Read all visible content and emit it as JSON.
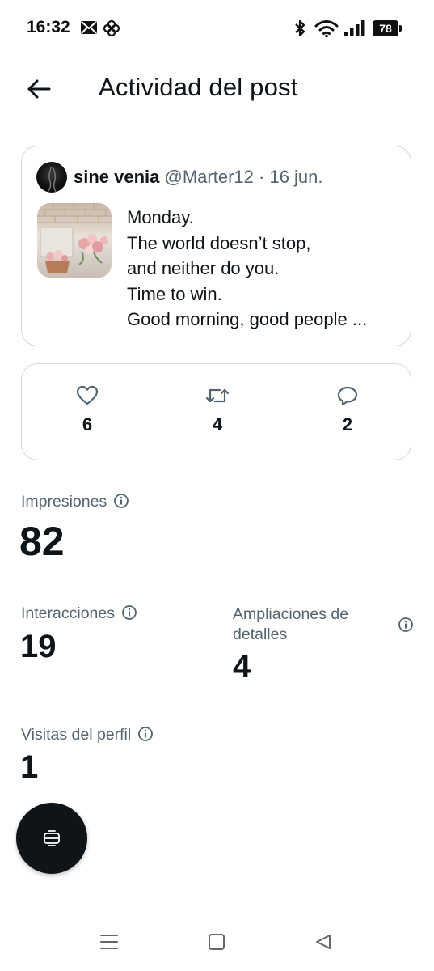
{
  "status_bar": {
    "time": "16:32",
    "battery": "78",
    "icons": [
      "mail-icon",
      "fan-icon",
      "bluetooth-icon",
      "wifi-icon",
      "signal-icon",
      "battery-icon"
    ]
  },
  "header": {
    "title": "Actividad del post",
    "back_icon": "arrow-left-icon"
  },
  "post": {
    "author_name": "sine venia",
    "author_handle": "@Marter12",
    "date": "· 16 jun.",
    "lines": [
      "Monday.",
      "The world doesn’t stop,",
      "and neither do you.",
      "Time to win.",
      "Good morning, good people ..."
    ]
  },
  "engagement": {
    "likes": "6",
    "reposts": "4",
    "replies": "2"
  },
  "metrics": {
    "impressions_label": "Impresiones",
    "impressions_value": "82",
    "interactions_label": "Interacciones",
    "interactions_value": "19",
    "expansions_label_1": "Ampliaciones de",
    "expansions_label_2": "detalles",
    "expansions_value": "4",
    "profile_visits_label": "Visitas del perfil",
    "profile_visits_value": "1"
  },
  "colors": {
    "text_primary": "#0f1419",
    "text_secondary": "#536471",
    "border": "#cfd9de",
    "fab_bg": "#0f1419"
  }
}
